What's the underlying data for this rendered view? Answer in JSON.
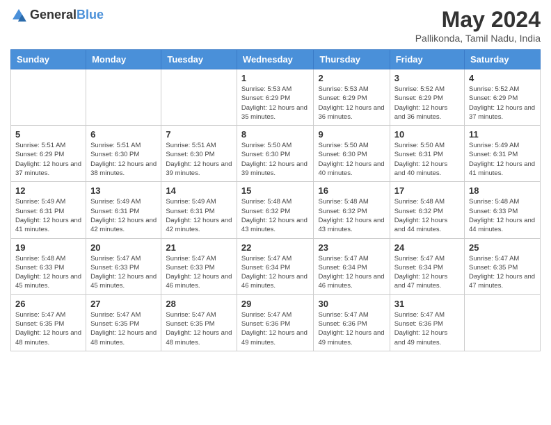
{
  "header": {
    "logo_general": "General",
    "logo_blue": "Blue",
    "month_title": "May 2024",
    "location": "Pallikonda, Tamil Nadu, India"
  },
  "days_of_week": [
    "Sunday",
    "Monday",
    "Tuesday",
    "Wednesday",
    "Thursday",
    "Friday",
    "Saturday"
  ],
  "weeks": [
    [
      {
        "day": "",
        "sunrise": "",
        "sunset": "",
        "daylight": ""
      },
      {
        "day": "",
        "sunrise": "",
        "sunset": "",
        "daylight": ""
      },
      {
        "day": "",
        "sunrise": "",
        "sunset": "",
        "daylight": ""
      },
      {
        "day": "1",
        "sunrise": "5:53 AM",
        "sunset": "6:29 PM",
        "daylight": "12 hours and 35 minutes."
      },
      {
        "day": "2",
        "sunrise": "5:53 AM",
        "sunset": "6:29 PM",
        "daylight": "12 hours and 36 minutes."
      },
      {
        "day": "3",
        "sunrise": "5:52 AM",
        "sunset": "6:29 PM",
        "daylight": "12 hours and 36 minutes."
      },
      {
        "day": "4",
        "sunrise": "5:52 AM",
        "sunset": "6:29 PM",
        "daylight": "12 hours and 37 minutes."
      }
    ],
    [
      {
        "day": "5",
        "sunrise": "5:51 AM",
        "sunset": "6:29 PM",
        "daylight": "12 hours and 37 minutes."
      },
      {
        "day": "6",
        "sunrise": "5:51 AM",
        "sunset": "6:30 PM",
        "daylight": "12 hours and 38 minutes."
      },
      {
        "day": "7",
        "sunrise": "5:51 AM",
        "sunset": "6:30 PM",
        "daylight": "12 hours and 39 minutes."
      },
      {
        "day": "8",
        "sunrise": "5:50 AM",
        "sunset": "6:30 PM",
        "daylight": "12 hours and 39 minutes."
      },
      {
        "day": "9",
        "sunrise": "5:50 AM",
        "sunset": "6:30 PM",
        "daylight": "12 hours and 40 minutes."
      },
      {
        "day": "10",
        "sunrise": "5:50 AM",
        "sunset": "6:31 PM",
        "daylight": "12 hours and 40 minutes."
      },
      {
        "day": "11",
        "sunrise": "5:49 AM",
        "sunset": "6:31 PM",
        "daylight": "12 hours and 41 minutes."
      }
    ],
    [
      {
        "day": "12",
        "sunrise": "5:49 AM",
        "sunset": "6:31 PM",
        "daylight": "12 hours and 41 minutes."
      },
      {
        "day": "13",
        "sunrise": "5:49 AM",
        "sunset": "6:31 PM",
        "daylight": "12 hours and 42 minutes."
      },
      {
        "day": "14",
        "sunrise": "5:49 AM",
        "sunset": "6:31 PM",
        "daylight": "12 hours and 42 minutes."
      },
      {
        "day": "15",
        "sunrise": "5:48 AM",
        "sunset": "6:32 PM",
        "daylight": "12 hours and 43 minutes."
      },
      {
        "day": "16",
        "sunrise": "5:48 AM",
        "sunset": "6:32 PM",
        "daylight": "12 hours and 43 minutes."
      },
      {
        "day": "17",
        "sunrise": "5:48 AM",
        "sunset": "6:32 PM",
        "daylight": "12 hours and 44 minutes."
      },
      {
        "day": "18",
        "sunrise": "5:48 AM",
        "sunset": "6:33 PM",
        "daylight": "12 hours and 44 minutes."
      }
    ],
    [
      {
        "day": "19",
        "sunrise": "5:48 AM",
        "sunset": "6:33 PM",
        "daylight": "12 hours and 45 minutes."
      },
      {
        "day": "20",
        "sunrise": "5:47 AM",
        "sunset": "6:33 PM",
        "daylight": "12 hours and 45 minutes."
      },
      {
        "day": "21",
        "sunrise": "5:47 AM",
        "sunset": "6:33 PM",
        "daylight": "12 hours and 46 minutes."
      },
      {
        "day": "22",
        "sunrise": "5:47 AM",
        "sunset": "6:34 PM",
        "daylight": "12 hours and 46 minutes."
      },
      {
        "day": "23",
        "sunrise": "5:47 AM",
        "sunset": "6:34 PM",
        "daylight": "12 hours and 46 minutes."
      },
      {
        "day": "24",
        "sunrise": "5:47 AM",
        "sunset": "6:34 PM",
        "daylight": "12 hours and 47 minutes."
      },
      {
        "day": "25",
        "sunrise": "5:47 AM",
        "sunset": "6:35 PM",
        "daylight": "12 hours and 47 minutes."
      }
    ],
    [
      {
        "day": "26",
        "sunrise": "5:47 AM",
        "sunset": "6:35 PM",
        "daylight": "12 hours and 48 minutes."
      },
      {
        "day": "27",
        "sunrise": "5:47 AM",
        "sunset": "6:35 PM",
        "daylight": "12 hours and 48 minutes."
      },
      {
        "day": "28",
        "sunrise": "5:47 AM",
        "sunset": "6:35 PM",
        "daylight": "12 hours and 48 minutes."
      },
      {
        "day": "29",
        "sunrise": "5:47 AM",
        "sunset": "6:36 PM",
        "daylight": "12 hours and 49 minutes."
      },
      {
        "day": "30",
        "sunrise": "5:47 AM",
        "sunset": "6:36 PM",
        "daylight": "12 hours and 49 minutes."
      },
      {
        "day": "31",
        "sunrise": "5:47 AM",
        "sunset": "6:36 PM",
        "daylight": "12 hours and 49 minutes."
      },
      {
        "day": "",
        "sunrise": "",
        "sunset": "",
        "daylight": ""
      }
    ]
  ]
}
